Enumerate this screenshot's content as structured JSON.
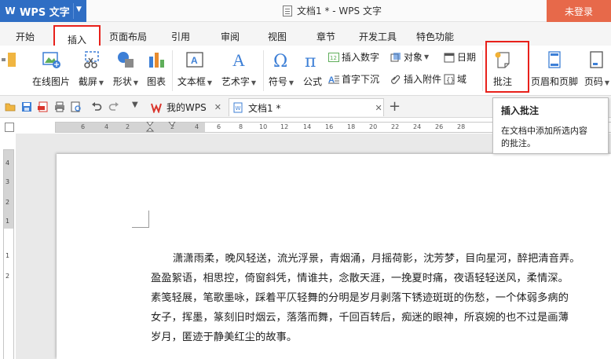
{
  "title_bar": {
    "app_name": "WPS 文字",
    "logo_letter": "W",
    "doc_title": "文档1 * - WPS 文字",
    "login_label": "未登录"
  },
  "tabs": [
    "开始",
    "插入",
    "页面布局",
    "引用",
    "审阅",
    "视图",
    "章节",
    "开发工具",
    "特色功能"
  ],
  "active_tab": "插入",
  "ribbon": {
    "online_picture": "在线图片",
    "screenshot": "截屏",
    "shape": "形状",
    "chart": "图表",
    "textbox": "文本框",
    "art_text": "艺术字",
    "symbol": "符号",
    "formula": "公式",
    "insert_number": "插入数字",
    "object": "对象",
    "date": "日期",
    "drop_cap": "首字下沉",
    "insert_attachment": "插入附件",
    "field": "域",
    "comment": "批注",
    "header_footer": "页眉和页脚",
    "page_number": "页码"
  },
  "quick_bar": {
    "my_wps_tab": "我的WPS",
    "doc_tab": "文档1 *"
  },
  "tooltip": {
    "title": "插入批注",
    "desc_line1": "在文档中添加所选内容",
    "desc_line2": "的批注。"
  },
  "ruler": {
    "h_labels": [
      "6",
      "4",
      "2",
      "2",
      "4",
      "6",
      "8",
      "10",
      "12",
      "14",
      "16",
      "18",
      "20",
      "22",
      "24",
      "26",
      "28"
    ],
    "v_labels": [
      "4",
      "3",
      "2",
      "1",
      "1",
      "2"
    ]
  },
  "document": {
    "lines": [
      "潇潇雨柔，晚风轻送，流光浮景，青烟涌，月摇荷影，沈芳梦，目向星河，醉把清音弄。",
      "盈盈絮语，相思控，倚窗斜凭，情谁共，念散天涯，一挽夏时痛，夜语轻轻送风，柔情深。",
      "素笺轻展，笔歌墨咏，踩着平仄轻舞的分明是岁月剥落下锈迹斑斑的伤愁，一个体弱多病的",
      "女子，挥墨，篆刻旧时烟云，落落而舞，千回百转后，痴迷的眼神，所哀婉的也不过是画薄",
      "岁月，匿迹于静美红尘的故事。"
    ]
  },
  "colors": {
    "app_blue": "#2f6ec4",
    "login_orange": "#e7694a",
    "highlight_red": "#e8211b",
    "icon_blue": "#3d7fd6"
  }
}
